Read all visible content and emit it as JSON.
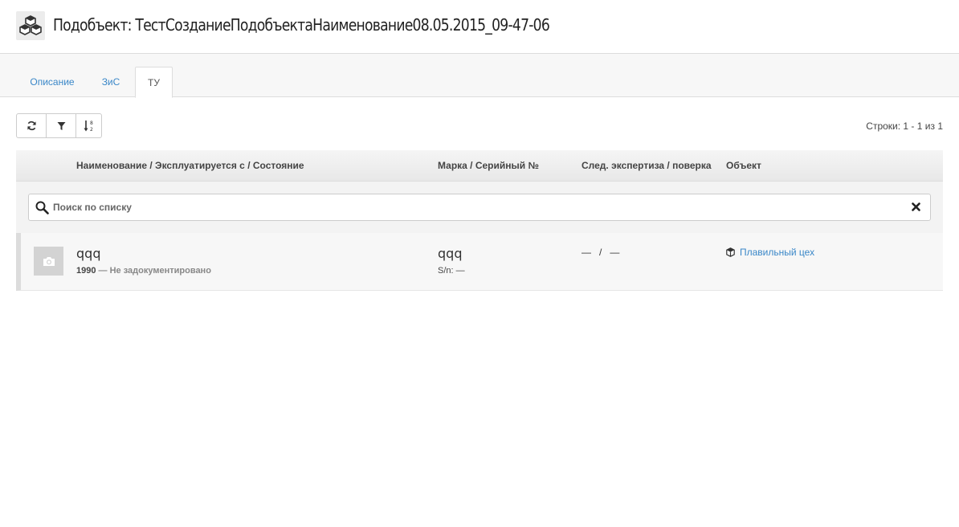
{
  "header": {
    "icon": "cubes-icon",
    "title": "Подобъект: ТестСозданиеПодобъектаНаименование08.05.2015_09-47-06"
  },
  "tabs": [
    {
      "label": "Описание",
      "active": false
    },
    {
      "label": "ЗиС",
      "active": false
    },
    {
      "label": "ТУ",
      "active": true
    }
  ],
  "toolbar": {
    "buttons": [
      "refresh-icon",
      "filter-icon",
      "sort-icon"
    ]
  },
  "rows_info": "Строки: 1 - 1 из 1",
  "table": {
    "columns": [
      "Наименование / Эксплуатируется с / Состояние",
      "Марка / Серийный №",
      "След. экспертиза / поверка",
      "Объект"
    ],
    "search_placeholder": "Поиск по списку",
    "rows": [
      {
        "thumb_icon": "camera-icon",
        "name": "qqq",
        "year": "1990",
        "state": " — Не задокументировано",
        "mark": "qqq",
        "serial": "S/n: —",
        "expertise": "—   /   —",
        "object_icon": "cube-icon",
        "object": "Плавильный цех"
      }
    ]
  },
  "colors": {
    "link": "#3a87c8",
    "header_border": "#dcdcdc",
    "thumb_bg": "#d3d3d3"
  }
}
